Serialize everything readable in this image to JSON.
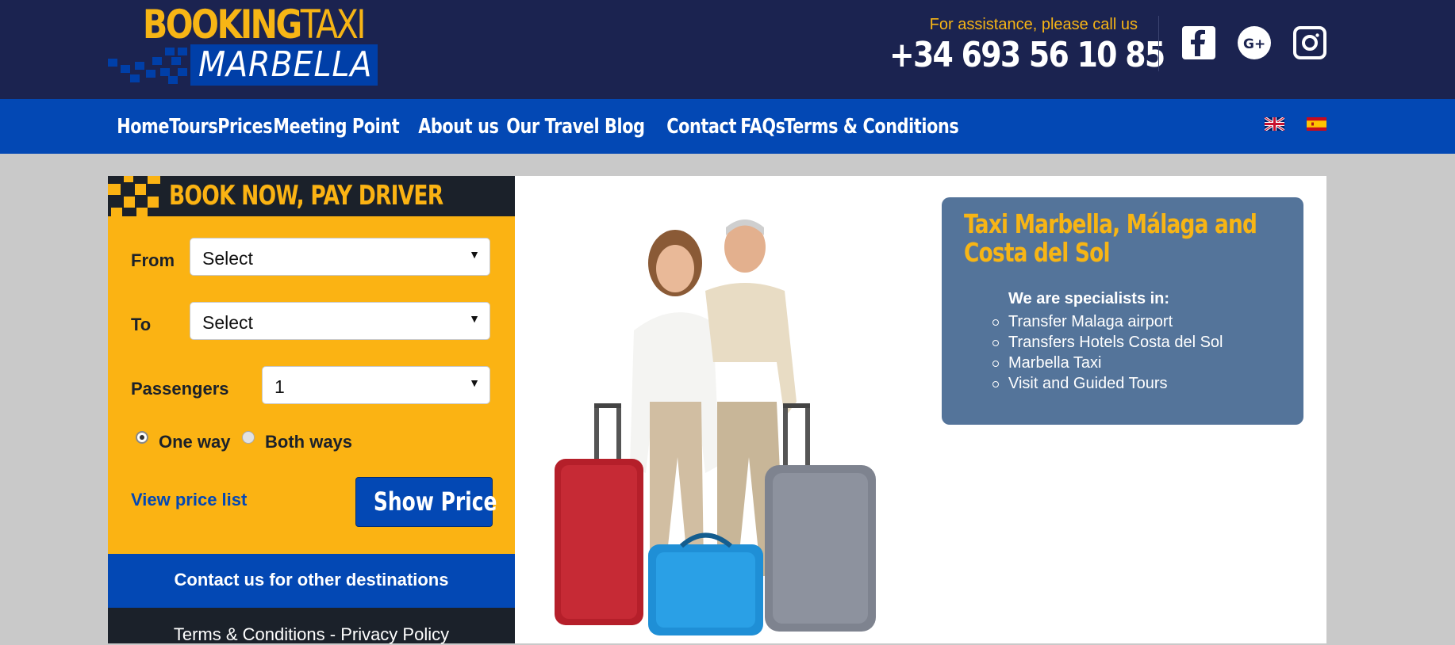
{
  "header": {
    "logo_top_bold": "BOOKING",
    "logo_top_light": "TAXI",
    "logo_bottom": "MARBELLA",
    "assist_text": "For assistance, please call us",
    "phone": "+34 693 56 10 85",
    "social": [
      "facebook-icon",
      "google-plus-icon",
      "instagram-icon"
    ]
  },
  "nav": {
    "items": [
      "Home",
      "Tours",
      "Prices",
      "Meeting Point",
      "About us",
      "Our Travel Blog",
      "Contact",
      "FAQs",
      "Terms & Conditions"
    ],
    "languages": [
      "English",
      "Español"
    ]
  },
  "booking": {
    "title": "BOOK NOW, PAY DRIVER",
    "from_label": "From",
    "from_value": "Select",
    "to_label": "To",
    "to_value": "Select",
    "passengers_label": "Passengers",
    "passengers_value": "1",
    "one_way": "One way",
    "both_ways": "Both ways",
    "trip_selected": "One way",
    "view_price_list": "View price list",
    "show_price": "Show Price",
    "contact_other": "Contact us for other destinations",
    "terms": "Terms & Conditions",
    "separator": " - ",
    "privacy": "Privacy Policy"
  },
  "info": {
    "title": "Taxi Marbella, Málaga and Costa del Sol",
    "specialists": "We are specialists in:",
    "services": [
      "Transfer Malaga airport",
      "Transfers Hotels Costa del Sol",
      "Marbella Taxi",
      "Visit and Guided Tours"
    ]
  },
  "colors": {
    "header_bg": "#1b2350",
    "nav_bg": "#0348b4",
    "accent_yellow": "#fbb313",
    "panel_dark": "#1b212a",
    "info_bg": "#54749a"
  }
}
